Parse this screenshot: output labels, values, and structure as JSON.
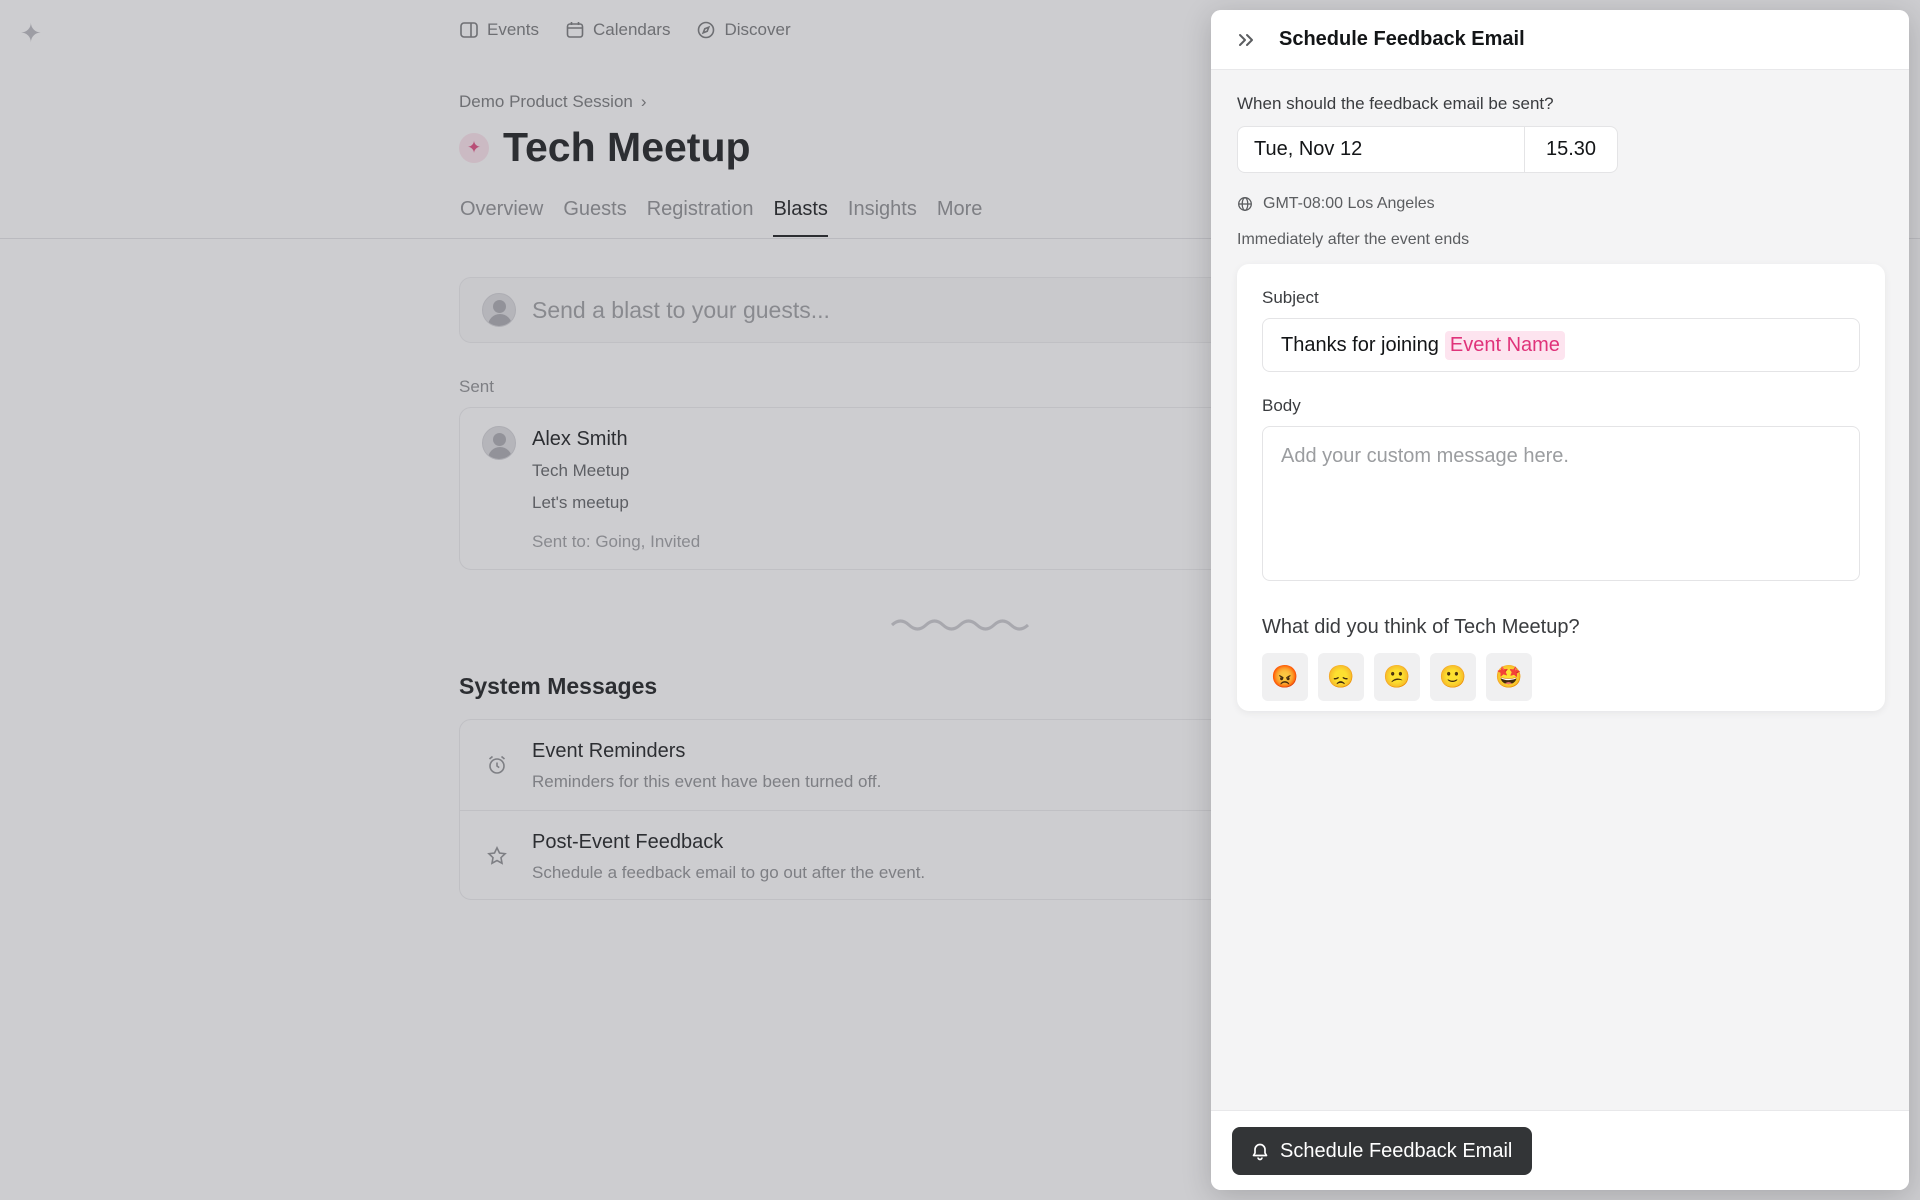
{
  "app": {
    "logo_icon": "sparkle-icon"
  },
  "nav": {
    "items": [
      {
        "label": "Events",
        "icon": "ticket-icon"
      },
      {
        "label": "Calendars",
        "icon": "calendar-icon"
      },
      {
        "label": "Discover",
        "icon": "compass-icon"
      }
    ]
  },
  "event": {
    "breadcrumb": "Demo Product Session",
    "title": "Tech Meetup"
  },
  "tabs": [
    "Overview",
    "Guests",
    "Registration",
    "Blasts",
    "Insights",
    "More"
  ],
  "active_tab": "Blasts",
  "blast": {
    "placeholder": "Send a blast to your guests..."
  },
  "sent": {
    "label": "Sent",
    "items": [
      {
        "name": "Alex Smith",
        "line1": "Tech Meetup",
        "line2": "Let's meetup",
        "to": "Sent to: Going, Invited"
      }
    ]
  },
  "system_messages": {
    "title": "System Messages",
    "items": [
      {
        "title": "Event Reminders",
        "desc": "Reminders for this event have been turned off.",
        "icon": "alarm-clock-icon"
      },
      {
        "title": "Post-Event Feedback",
        "desc": "Schedule a feedback email to go out after the event.",
        "icon": "star-icon"
      }
    ]
  },
  "drawer": {
    "title": "Schedule Feedback Email",
    "when_label": "When should the feedback email be sent?",
    "date": "Tue, Nov 12",
    "time": "15.30",
    "timezone": "GMT-08:00 Los Angeles",
    "after_note": "Immediately after the event ends",
    "subject_label": "Subject",
    "subject_text": "Thanks for joining",
    "subject_token": "Event Name",
    "body_label": "Body",
    "body_placeholder": "Add your custom message here.",
    "rating_question": "What did you think of Tech Meetup?",
    "ratings": [
      "😡",
      "😞",
      "😕",
      "🙂",
      "🤩"
    ],
    "submit_label": "Schedule Feedback Email"
  },
  "colors": {
    "accent_pink": "#e0337a",
    "button_dark": "#333537"
  }
}
